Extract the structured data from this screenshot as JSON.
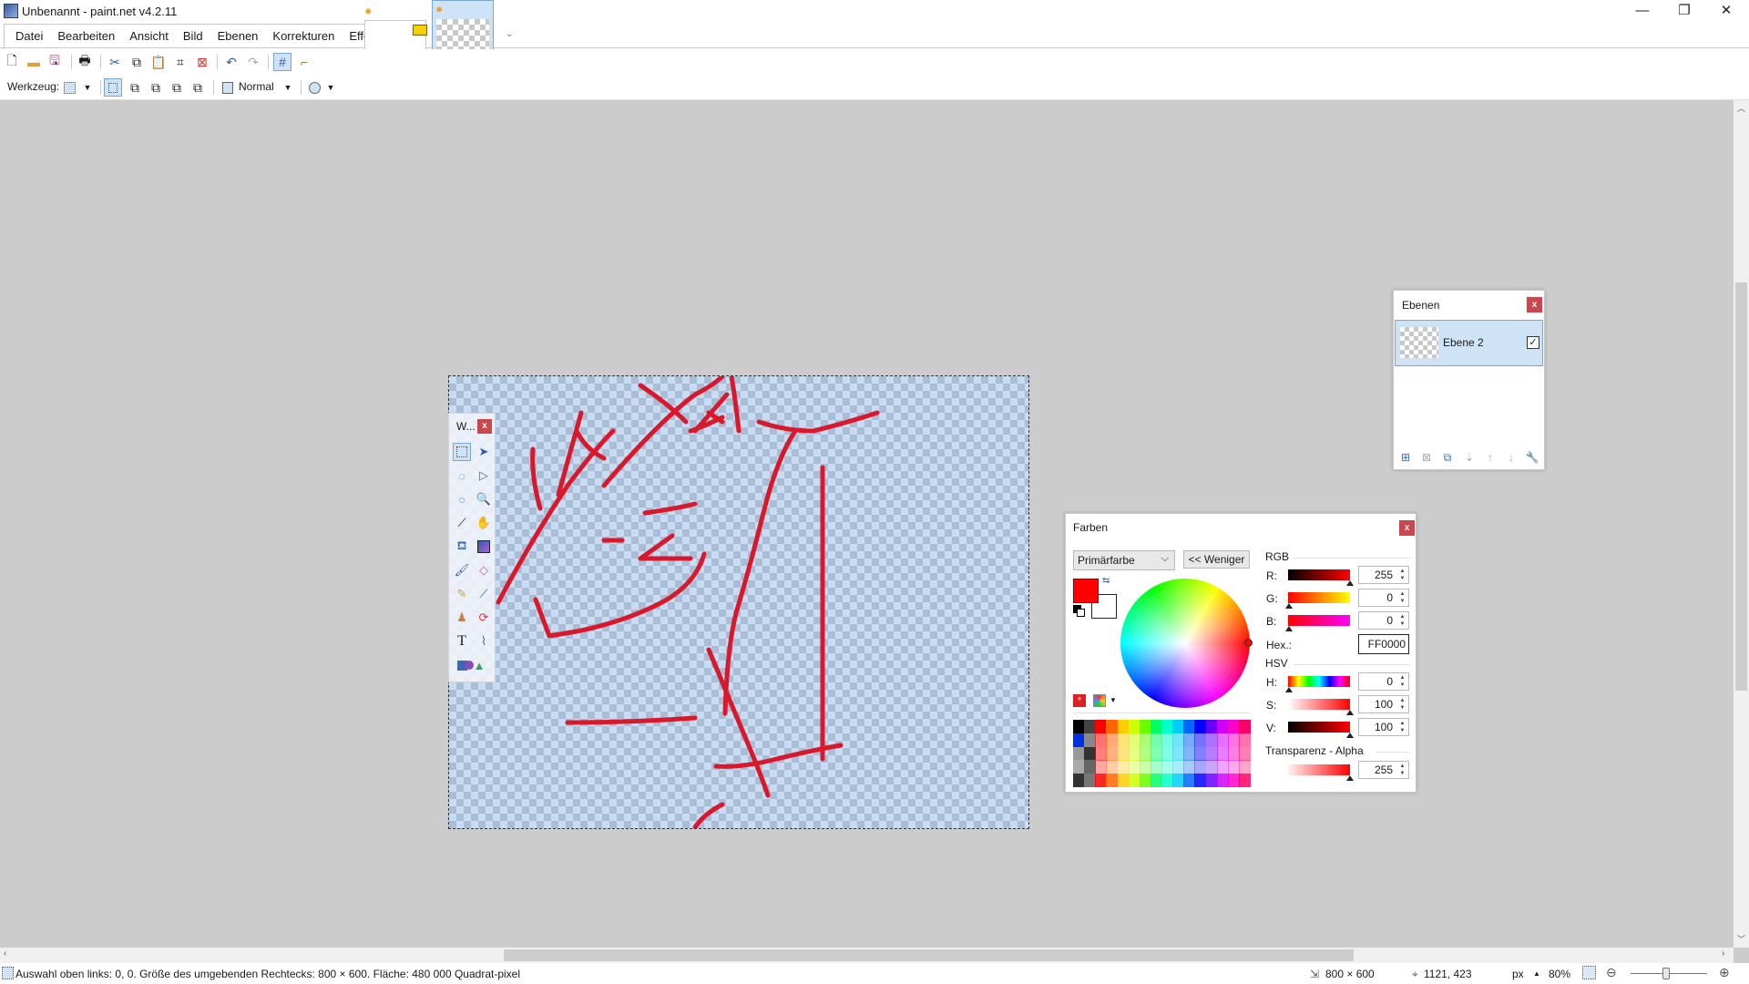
{
  "window": {
    "title": "Unbenannt - paint.net v4.2.11",
    "minimize": "—",
    "maximize": "❐",
    "close": "✕"
  },
  "menu": [
    "Datei",
    "Bearbeiten",
    "Ansicht",
    "Bild",
    "Ebenen",
    "Korrekturen",
    "Effekte"
  ],
  "toolbar2": {
    "tool_label": "Werkzeug:",
    "blend_mode": "Normal"
  },
  "tools_window": {
    "title": "W...",
    "close": "x",
    "tools": [
      "rectangle-select",
      "move-selected-pixels",
      "lasso-select",
      "move-selection",
      "ellipse-select",
      "zoom",
      "magic-wand",
      "pan",
      "paint-bucket",
      "gradient",
      "paintbrush",
      "eraser",
      "pencil",
      "color-picker",
      "clone-stamp",
      "recolor",
      "text",
      "line-curve",
      "shapes"
    ]
  },
  "layers": {
    "title": "Ebenen",
    "close": "x",
    "items": [
      {
        "name": "Ebene 2",
        "visible": true,
        "checkmark": "✓"
      }
    ]
  },
  "colors": {
    "title": "Farben",
    "close": "x",
    "target": "Primärfarbe",
    "less_button": "<< Weniger",
    "primary": "#ff0000",
    "secondary": "#ffffff",
    "rgb_label": "RGB",
    "r_label": "R:",
    "r": "255",
    "g_label": "G:",
    "g": "0",
    "b_label": "B:",
    "b": "0",
    "hex_label": "Hex.:",
    "hex": "FF0000",
    "hsv_label": "HSV",
    "h_label": "H:",
    "h": "0",
    "s_label": "S:",
    "s": "100",
    "v_label": "V:",
    "v": "100",
    "alpha_label": "Transparenz - Alpha",
    "alpha": "255"
  },
  "status": {
    "selection_info": "Auswahl oben links: 0, 0. Größe des umgebenden Rechtecks: 800 × 600. Fläche: 480 000 Quadrat-pixel",
    "image_size": "800 × 600",
    "cursor_pos": "1121, 423",
    "unit": "px",
    "zoom": "80%"
  },
  "brush_color": "#d9182c"
}
